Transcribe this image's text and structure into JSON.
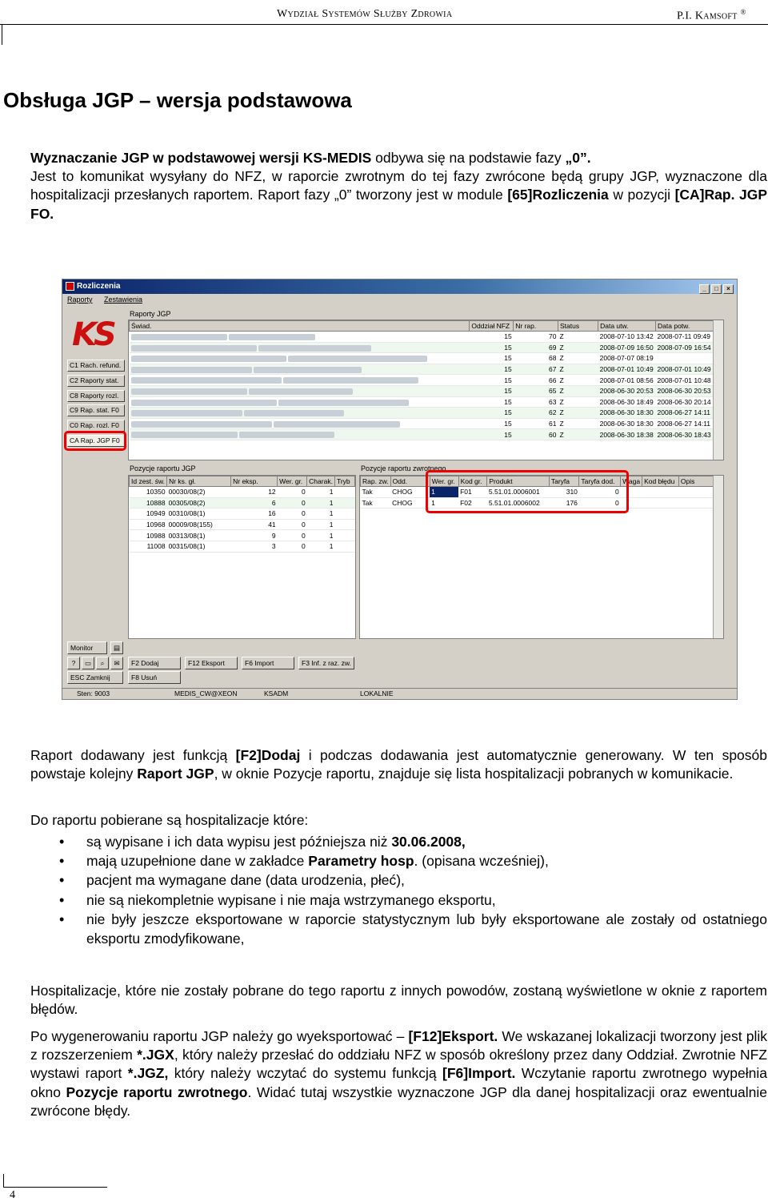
{
  "header": {
    "left": "Wydział Systemów Służby Zdrowia",
    "right": "P.I. Kamsoft",
    "reg": "®"
  },
  "title": "Obsługa JGP – wersja podstawowa",
  "intro": {
    "l1a": "Wyznaczanie JGP w podstawowej wersji KS-MEDIS",
    "l1b": " odbywa się na podstawie fazy ",
    "l1c": "„0”.",
    "l2": "Jest to komunikat wysyłany do NFZ, w raporcie zwrotnym do tej fazy zwrócone będą grupy JGP, wyznaczone dla hospitalizacji przesłanych raportem. Raport fazy „0” tworzony jest w module ",
    "l2b": "[65]Rozliczenia",
    "l2c": " w pozycji ",
    "l2d": "[CA]Rap. JGP FO."
  },
  "app": {
    "window_title": "Rozliczenia",
    "menu": [
      "Raporty",
      "Zestawienia"
    ],
    "nav": [
      "C1 Rach. refund.",
      "C2 Raporty stat.",
      "C8 Raporty rozl.",
      "C9 Rap. stat. F0",
      "C0 Rap. rozl. F0",
      "CA Rap. JGP F0"
    ],
    "top_panel_title": "Raporty JGP",
    "top_cols": [
      "Świad.",
      "Oddział NFZ",
      "Nr rap.",
      "Status",
      "Data utw.",
      "Data potw."
    ],
    "top_rows": [
      [
        "15",
        "70",
        "Z",
        "2008-07-10 13:42",
        "2008-07-11 09:49"
      ],
      [
        "15",
        "69",
        "Z",
        "2008-07-09 16:50",
        "2008-07-09 16:54"
      ],
      [
        "15",
        "68",
        "Z",
        "2008-07-07 08:19",
        ""
      ],
      [
        "15",
        "67",
        "Z",
        "2008-07-01 10:49",
        "2008-07-01 10:49"
      ],
      [
        "15",
        "66",
        "Z",
        "2008-07-01 08:56",
        "2008-07-01 10:48"
      ],
      [
        "15",
        "65",
        "Z",
        "2008-06-30 20:53",
        "2008-06-30 20:53"
      ],
      [
        "15",
        "63",
        "Z",
        "2008-06-30 18:49",
        "2008-06-30 20:14"
      ],
      [
        "15",
        "62",
        "Z",
        "2008-06-30 18:30",
        "2008-06-27 14:11"
      ],
      [
        "15",
        "61",
        "Z",
        "2008-06-30 18:30",
        "2008-06-27 14:11"
      ],
      [
        "15",
        "60",
        "Z",
        "2008-06-30 18:38",
        "2008-06-30 18:43"
      ]
    ],
    "pos_title": "Pozycje raportu JGP",
    "pos_cols": [
      "Id zest. św.",
      "Nr ks. gł.",
      "Nr eksp.",
      "Wer. gr.",
      "Charak.",
      "Tryb"
    ],
    "pos_rows": [
      [
        "10350",
        "00030/08(2)",
        "12",
        "0",
        "1"
      ],
      [
        "10888",
        "00305/08(2)",
        "6",
        "0",
        "1"
      ],
      [
        "10949",
        "00310/08(1)",
        "16",
        "0",
        "1"
      ],
      [
        "10968",
        "00009/08(155)",
        "41",
        "0",
        "1"
      ],
      [
        "10988",
        "00313/08(1)",
        "9",
        "0",
        "1"
      ],
      [
        "11008",
        "00315/08(1)",
        "3",
        "0",
        "1"
      ]
    ],
    "ret_title": "Pozycje raportu zwrotnego",
    "ret_cols": [
      "Rap. zw.",
      "Odd.",
      "Wer. gr.",
      "Kod gr.",
      "Produkt",
      "Taryfa",
      "Taryfa dod.",
      "Waga",
      "Kod błędu",
      "Opis"
    ],
    "ret_rows": [
      [
        "Tak",
        "CHOG",
        "1",
        "F01",
        "5.51.01.0006001",
        "310",
        "0"
      ],
      [
        "Tak",
        "CHOG",
        "1",
        "F02",
        "5.51.01.0006002",
        "176",
        "0"
      ]
    ],
    "buttons": {
      "monitor": "Monitor",
      "dodaj": "F2 Dodaj",
      "eksport": "F12 Eksport",
      "import": "F6 Import",
      "inf": "F3 Inf. z raz. zw.",
      "zamknij": "ESC Zamknij",
      "usun": "F8 Usuń"
    },
    "status": {
      "sten": "Sten: 9003",
      "db": "MEDIS_CW@XEON",
      "mod": "KSADM",
      "loc": "LOKALNIE"
    }
  },
  "p1": {
    "a": "Raport dodawany jest funkcją ",
    "b": "[F2]Dodaj",
    "c": " i podczas dodawania jest automatycznie generowany. W ten sposób powstaje kolejny ",
    "d": "Raport JGP",
    "e": ", w oknie Pozycje raportu, znajduje się lista hospitalizacji pobranych w komunikacie."
  },
  "p2": "Do raportu pobierane są hospitalizacje które:",
  "bullets": {
    "b1a": "są wypisane i ich data wypisu jest późniejsza niż ",
    "b1b": "30.06.2008,",
    "b2a": "mają uzupełnione dane w zakładce ",
    "b2b": "Parametry hosp",
    "b2c": ". (opisana wcześniej),",
    "b3": "pacjent ma wymagane dane (data urodzenia, płeć),",
    "b4": "nie są niekompletnie wypisane i nie maja wstrzymanego eksportu,",
    "b5": "nie były jeszcze eksportowane w raporcie statystycznym lub były eksportowane ale  zostały od ostatniego eksportu zmodyfikowane,"
  },
  "p3": "Hospitalizacje, które nie zostały pobrane do tego raportu z innych powodów, zostaną wyświetlone w oknie z raportem błędów.",
  "p4": {
    "a": "Po wygenerowaniu raportu JGP należy go wyeksportować – ",
    "b": "[F12]Eksport.",
    "c": " We wskazanej lokalizacji tworzony jest plik z rozszerzeniem ",
    "d": "*.JGX",
    "e": ", który należy przesłać do oddziału NFZ w sposób określony przez dany Oddział.  Zwrotnie NFZ wystawi raport ",
    "f": "*.JGZ,",
    "g": " który należy wczytać do systemu funkcją ",
    "h": "[F6]Import.",
    "i": " Wczytanie raportu zwrotnego wypełnia okno ",
    "j": "Pozycje raportu zwrotnego",
    "k": ". Widać tutaj wszystkie wyznaczone JGP dla danej hospitalizacji oraz ewentualnie zwrócone błędy."
  },
  "page_number": "4"
}
